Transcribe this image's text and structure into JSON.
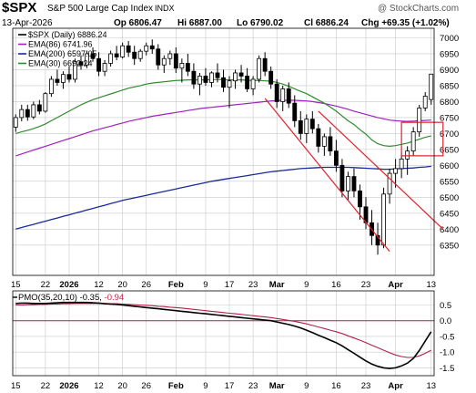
{
  "chart_data": [
    {
      "type": "candlestick",
      "symbol": "$SPX",
      "title": "S&P 500 Large Cap Index",
      "exchange": "INDX",
      "date": "13-Apr-2026",
      "ohlc_header": {
        "op": "Op 6806.47",
        "hi": "Hi 6887.00",
        "lo": "Lo 6790.02",
        "cl": "Cl 6886.24",
        "chg": "Chg +69.35 (+1.02%)"
      },
      "watermark": "@ StockCharts.com",
      "legend": [
        {
          "name": "$SPX (Daily) 6886.24",
          "color": "#000000"
        },
        {
          "name": "EMA(86) 6741.96",
          "color": "#a020c0"
        },
        {
          "name": "EMA(200) 6597.05",
          "color": "#1a2a9a"
        },
        {
          "name": "EMA(30) 6692.24",
          "color": "#2e8b2e"
        }
      ],
      "ylim": [
        6255,
        7030
      ],
      "yticks": [
        "7000",
        "6950",
        "6900",
        "6850",
        "6800",
        "6750",
        "6700",
        "6650",
        "6600",
        "6550",
        "6500",
        "6450",
        "6400",
        "6350"
      ],
      "x_labels": [
        {
          "i": 0,
          "text": "15"
        },
        {
          "i": 5,
          "text": "22"
        },
        {
          "i": 9,
          "text": "2026"
        },
        {
          "i": 14,
          "text": "12"
        },
        {
          "i": 18,
          "text": "20"
        },
        {
          "i": 22,
          "text": "26"
        },
        {
          "i": 27,
          "text": "Feb"
        },
        {
          "i": 32,
          "text": "9"
        },
        {
          "i": 36,
          "text": "17"
        },
        {
          "i": 40,
          "text": "23"
        },
        {
          "i": 44,
          "text": "Mar"
        },
        {
          "i": 49,
          "text": "9"
        },
        {
          "i": 54,
          "text": "16"
        },
        {
          "i": 59,
          "text": "23"
        },
        {
          "i": 64,
          "text": "Apr"
        },
        {
          "i": 70,
          "text": "13"
        }
      ],
      "candles": [
        [
          6720,
          6760,
          6705,
          6750
        ],
        [
          6750,
          6790,
          6738,
          6775
        ],
        [
          6775,
          6790,
          6740,
          6752
        ],
        [
          6752,
          6800,
          6745,
          6790
        ],
        [
          6790,
          6805,
          6760,
          6770
        ],
        [
          6770,
          6830,
          6765,
          6825
        ],
        [
          6825,
          6880,
          6815,
          6870
        ],
        [
          6870,
          6900,
          6850,
          6860
        ],
        [
          6860,
          6895,
          6840,
          6885
        ],
        [
          6885,
          6910,
          6860,
          6870
        ],
        [
          6870,
          6935,
          6860,
          6925
        ],
        [
          6925,
          6945,
          6900,
          6915
        ],
        [
          6915,
          6960,
          6905,
          6950
        ],
        [
          6950,
          6970,
          6925,
          6935
        ],
        [
          6935,
          6955,
          6880,
          6895
        ],
        [
          6895,
          6930,
          6880,
          6920
        ],
        [
          6920,
          6960,
          6910,
          6950
        ],
        [
          6950,
          6975,
          6930,
          6940
        ],
        [
          6940,
          6985,
          6935,
          6975
        ],
        [
          6975,
          6990,
          6940,
          6955
        ],
        [
          6955,
          6975,
          6915,
          6935
        ],
        [
          6935,
          6965,
          6925,
          6958
        ],
        [
          6958,
          6985,
          6945,
          6975
        ],
        [
          6975,
          6995,
          6950,
          6965
        ],
        [
          6965,
          6980,
          6900,
          6915
        ],
        [
          6915,
          6945,
          6890,
          6935
        ],
        [
          6935,
          6960,
          6915,
          6950
        ],
        [
          6950,
          6970,
          6890,
          6905
        ],
        [
          6905,
          6935,
          6860,
          6920
        ],
        [
          6920,
          6950,
          6880,
          6895
        ],
        [
          6895,
          6920,
          6840,
          6855
        ],
        [
          6855,
          6890,
          6820,
          6880
        ],
        [
          6880,
          6905,
          6850,
          6860
        ],
        [
          6860,
          6895,
          6845,
          6890
        ],
        [
          6890,
          6920,
          6860,
          6875
        ],
        [
          6875,
          6900,
          6830,
          6845
        ],
        [
          6845,
          6880,
          6780,
          6865
        ],
        [
          6865,
          6900,
          6840,
          6890
        ],
        [
          6890,
          6915,
          6860,
          6880
        ],
        [
          6880,
          6905,
          6830,
          6840
        ],
        [
          6840,
          6880,
          6820,
          6870
        ],
        [
          6870,
          6945,
          6860,
          6935
        ],
        [
          6935,
          6955,
          6880,
          6895
        ],
        [
          6895,
          6910,
          6840,
          6855
        ],
        [
          6855,
          6870,
          6780,
          6800
        ],
        [
          6800,
          6850,
          6770,
          6840
        ],
        [
          6840,
          6860,
          6780,
          6795
        ],
        [
          6795,
          6820,
          6720,
          6740
        ],
        [
          6740,
          6770,
          6680,
          6700
        ],
        [
          6700,
          6760,
          6670,
          6745
        ],
        [
          6745,
          6770,
          6700,
          6715
        ],
        [
          6715,
          6730,
          6640,
          6660
        ],
        [
          6660,
          6700,
          6630,
          6690
        ],
        [
          6690,
          6720,
          6630,
          6645
        ],
        [
          6645,
          6680,
          6580,
          6600
        ],
        [
          6600,
          6620,
          6500,
          6520
        ],
        [
          6520,
          6580,
          6490,
          6565
        ],
        [
          6565,
          6590,
          6500,
          6520
        ],
        [
          6520,
          6540,
          6430,
          6470
        ],
        [
          6470,
          6500,
          6400,
          6420
        ],
        [
          6420,
          6460,
          6350,
          6380
        ],
        [
          6380,
          6420,
          6320,
          6350
        ],
        [
          6350,
          6530,
          6340,
          6510
        ],
        [
          6510,
          6590,
          6480,
          6575
        ],
        [
          6575,
          6620,
          6530,
          6590
        ],
        [
          6590,
          6640,
          6560,
          6620
        ],
        [
          6620,
          6660,
          6570,
          6645
        ],
        [
          6645,
          6720,
          6630,
          6705
        ],
        [
          6705,
          6790,
          6690,
          6780
        ],
        [
          6780,
          6830,
          6770,
          6817
        ],
        [
          6806.47,
          6887.0,
          6790.02,
          6886.24
        ]
      ],
      "ema30": [
        6700,
        6705,
        6710,
        6715,
        6722,
        6730,
        6740,
        6750,
        6760,
        6770,
        6780,
        6790,
        6798,
        6806,
        6812,
        6818,
        6824,
        6830,
        6836,
        6842,
        6846,
        6850,
        6855,
        6858,
        6860,
        6862,
        6864,
        6866,
        6867,
        6868,
        6868,
        6868,
        6868,
        6869,
        6869,
        6869,
        6868,
        6868,
        6868,
        6867,
        6866,
        6866,
        6865,
        6864,
        6860,
        6855,
        6848,
        6840,
        6832,
        6825,
        6815,
        6805,
        6795,
        6783,
        6770,
        6755,
        6740,
        6728,
        6712,
        6698,
        6680,
        6668,
        6662,
        6660,
        6662,
        6666,
        6670,
        6676,
        6682,
        6688,
        6692.24
      ],
      "ema86": [
        6630,
        6636,
        6642,
        6648,
        6654,
        6660,
        6666,
        6672,
        6678,
        6684,
        6690,
        6696,
        6702,
        6708,
        6713,
        6718,
        6723,
        6728,
        6733,
        6738,
        6742,
        6746,
        6750,
        6754,
        6757,
        6760,
        6763,
        6766,
        6769,
        6772,
        6775,
        6778,
        6780,
        6782,
        6784,
        6786,
        6788,
        6790,
        6792,
        6794,
        6796,
        6798,
        6800,
        6802,
        6803,
        6804,
        6804,
        6804,
        6803,
        6802,
        6800,
        6797,
        6794,
        6790,
        6786,
        6781,
        6776,
        6770,
        6765,
        6760,
        6755,
        6750,
        6746,
        6742,
        6740,
        6739,
        6738,
        6739,
        6740,
        6741,
        6741.96
      ],
      "ema200": [
        6400,
        6405,
        6410,
        6415,
        6420,
        6425,
        6430,
        6435,
        6440,
        6445,
        6450,
        6455,
        6460,
        6465,
        6470,
        6475,
        6480,
        6485,
        6490,
        6494,
        6498,
        6502,
        6506,
        6510,
        6514,
        6518,
        6522,
        6526,
        6530,
        6534,
        6538,
        6542,
        6546,
        6550,
        6553,
        6556,
        6559,
        6562,
        6565,
        6568,
        6571,
        6574,
        6577,
        6580,
        6582,
        6584,
        6586,
        6588,
        6590,
        6591,
        6592,
        6593,
        6594,
        6594,
        6594,
        6594,
        6594,
        6593,
        6592,
        6591,
        6590,
        6589,
        6588,
        6588,
        6589,
        6590,
        6591,
        6592,
        6594,
        6595,
        6597.05
      ],
      "channel": [
        {
          "i1": 42,
          "v1": 6810,
          "i2": 63,
          "v2": 6330
        },
        {
          "i1": 51,
          "v1": 6770,
          "i2": 72,
          "v2": 6400
        }
      ],
      "highlight_box": {
        "i1": 65,
        "v1": 6735,
        "i2": 72,
        "v2": 6630
      }
    },
    {
      "type": "line",
      "title": "PMO(35,20,10) -0.35, -0.94",
      "label": "PMO(35,20,10)",
      "value1": "-0.35",
      "value2": "-0.94",
      "ylim": [
        -1.75,
        0.95
      ],
      "yticks": [
        "0.5",
        "0.0",
        "-0.5",
        "-1.0",
        "-1.5"
      ],
      "zero_line": 0.0,
      "pmo": [
        0.55,
        0.56,
        0.56,
        0.55,
        0.55,
        0.55,
        0.56,
        0.57,
        0.58,
        0.58,
        0.58,
        0.58,
        0.58,
        0.57,
        0.56,
        0.54,
        0.53,
        0.52,
        0.5,
        0.48,
        0.46,
        0.44,
        0.42,
        0.4,
        0.38,
        0.36,
        0.34,
        0.32,
        0.3,
        0.28,
        0.26,
        0.24,
        0.22,
        0.2,
        0.18,
        0.16,
        0.14,
        0.12,
        0.1,
        0.08,
        0.06,
        0.04,
        0.02,
        0.0,
        -0.04,
        -0.08,
        -0.12,
        -0.17,
        -0.23,
        -0.3,
        -0.38,
        -0.46,
        -0.54,
        -0.62,
        -0.7,
        -0.8,
        -0.92,
        -1.04,
        -1.16,
        -1.28,
        -1.38,
        -1.45,
        -1.5,
        -1.52,
        -1.5,
        -1.44,
        -1.35,
        -1.2,
        -0.95,
        -0.65,
        -0.35
      ],
      "signal": [
        0.5,
        0.5,
        0.51,
        0.51,
        0.52,
        0.52,
        0.53,
        0.53,
        0.54,
        0.54,
        0.55,
        0.55,
        0.55,
        0.55,
        0.55,
        0.55,
        0.54,
        0.54,
        0.53,
        0.52,
        0.51,
        0.5,
        0.49,
        0.48,
        0.46,
        0.45,
        0.43,
        0.42,
        0.4,
        0.38,
        0.36,
        0.34,
        0.32,
        0.3,
        0.28,
        0.26,
        0.24,
        0.22,
        0.2,
        0.18,
        0.16,
        0.14,
        0.12,
        0.1,
        0.07,
        0.04,
        0.01,
        -0.02,
        -0.06,
        -0.1,
        -0.15,
        -0.2,
        -0.25,
        -0.3,
        -0.35,
        -0.41,
        -0.48,
        -0.55,
        -0.62,
        -0.7,
        -0.78,
        -0.86,
        -0.94,
        -1.02,
        -1.09,
        -1.14,
        -1.17,
        -1.17,
        -1.12,
        -1.04,
        -0.94
      ]
    }
  ]
}
